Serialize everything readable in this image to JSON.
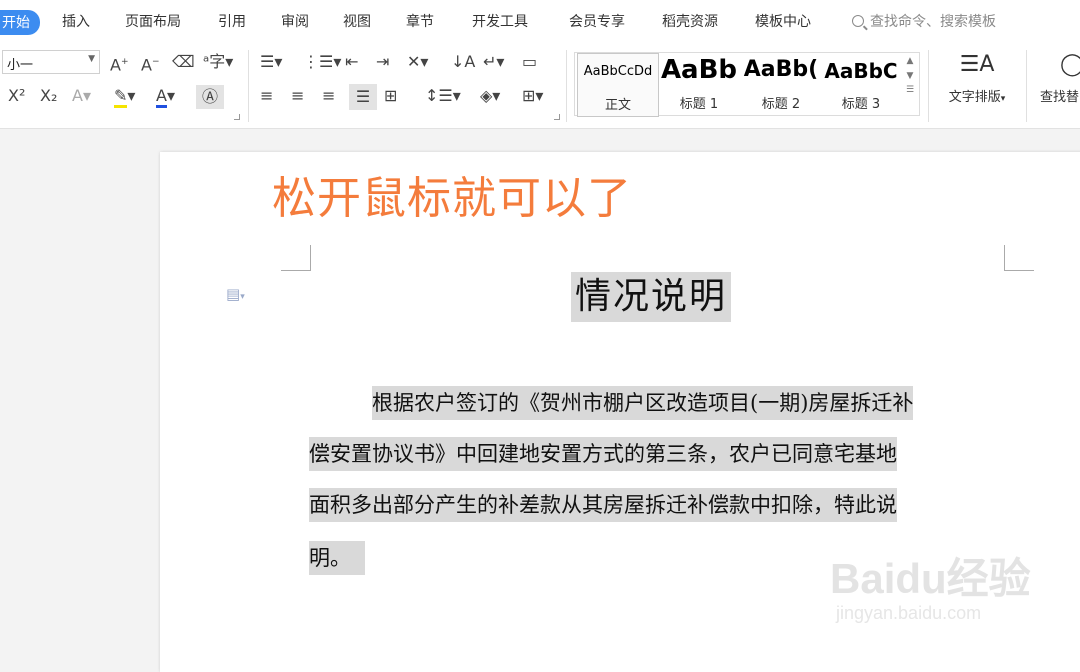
{
  "menu": {
    "tabs": [
      "开始",
      "插入",
      "页面布局",
      "引用",
      "审阅",
      "视图",
      "章节",
      "开发工具",
      "会员专享",
      "稻壳资源",
      "模板中心"
    ],
    "search_placeholder": "查找命令、搜索模板"
  },
  "ribbon": {
    "font_size_value": "小一",
    "styles": [
      {
        "sample": "AaBbCcDd",
        "label": "正文"
      },
      {
        "sample": "AaBb",
        "label": "标题 1"
      },
      {
        "sample": "AaBb(",
        "label": "标题 2"
      },
      {
        "sample": "AaBbC",
        "label": "标题 3"
      }
    ],
    "text_layout_label": "文字排版",
    "find_replace_label": "查找替"
  },
  "overlay_caption": "松开鼠标就可以了",
  "document": {
    "title": "情况说明",
    "lines": [
      "根据农户签订的《贺州市棚户区改造项目(一期)房屋拆迁补",
      "偿安置协议书》中回建地安置方式的第三条，农户已同意宅基地",
      "面积多出部分产生的补差款从其房屋拆迁补偿款中扣除，特此说",
      "明。"
    ]
  },
  "watermark": {
    "brand": "Baidu经验",
    "url": "jingyan.baidu.com"
  },
  "colors": {
    "accent": "#3c8cf0",
    "caption": "#f47c3c",
    "selection": "#d9d9d9"
  }
}
